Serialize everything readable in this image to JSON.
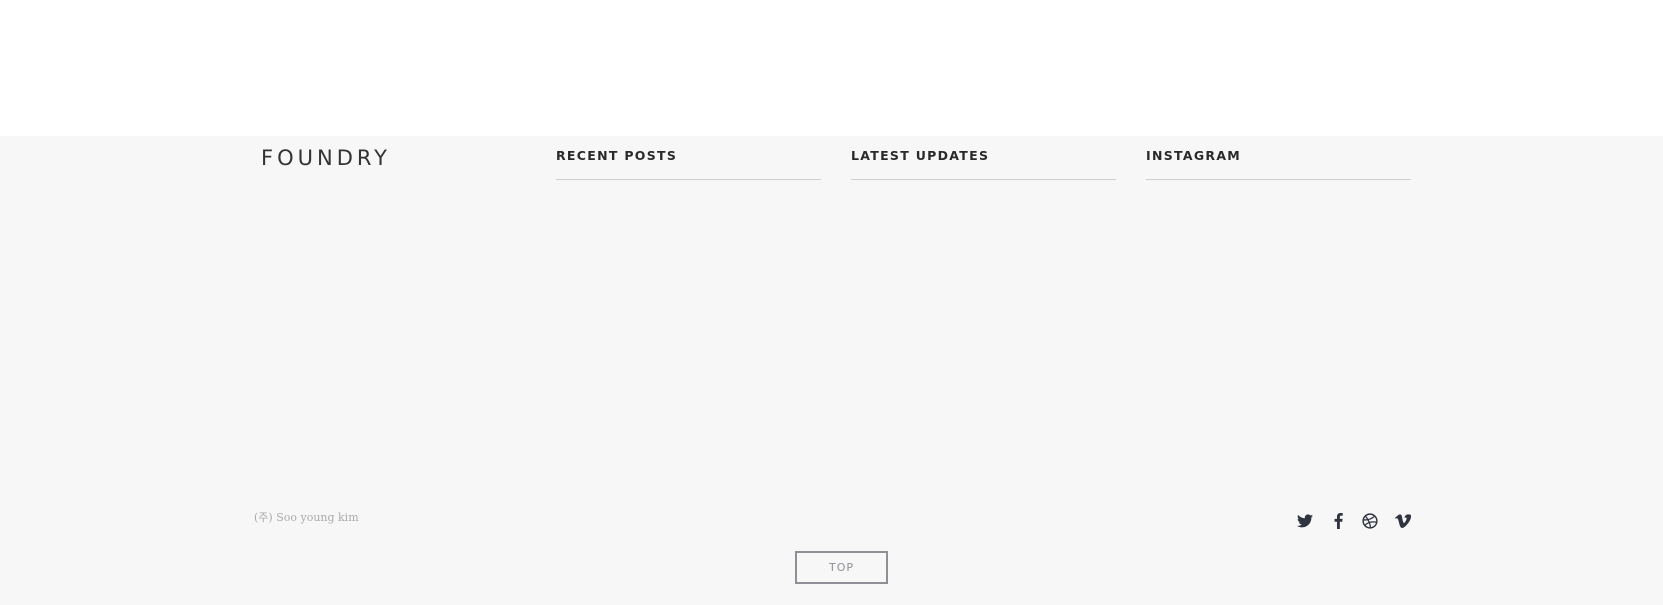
{
  "footer": {
    "logo": "FOUNDRY",
    "widgets": [
      {
        "title": "RECENT POSTS"
      },
      {
        "title": "LATEST UPDATES"
      },
      {
        "title": "INSTAGRAM"
      }
    ],
    "copyright": "(주) Soo young kim",
    "social": [
      {
        "icon": "twitter-icon"
      },
      {
        "icon": "facebook-icon"
      },
      {
        "icon": "dribbble-icon"
      },
      {
        "icon": "vimeo-icon"
      }
    ],
    "top_button_label": "TOP",
    "colors": {
      "background": "#f7f7f7",
      "text_dark": "#2a2a2a",
      "muted": "#aaaaaa",
      "button_border": "#8f9096",
      "icon": "#2f3440"
    }
  }
}
